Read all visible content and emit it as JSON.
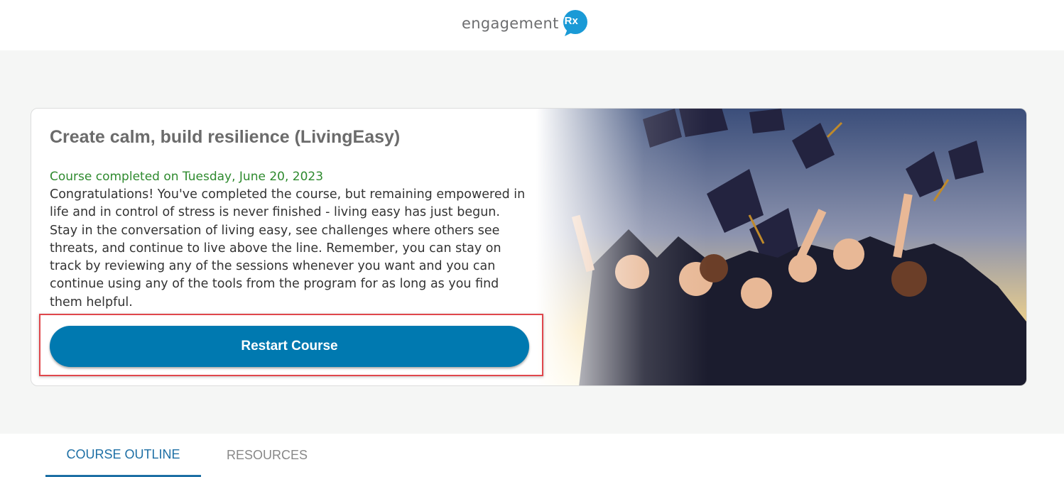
{
  "header": {
    "logo_text": "engagement",
    "logo_badge": "Rx",
    "brand_color": "#1a9ad6"
  },
  "course": {
    "title": "Create calm, build resilience (LivingEasy)",
    "completed_text": "Course completed on Tuesday, June 20, 2023",
    "body": "Congratulations! You've completed the course, but remaining empowered in life and in control of stress is never finished - living easy has just begun. Stay in the conversation of living easy, see challenges where others see threats, and continue to live above the line. Remember, you can stay on track by reviewing any of the sessions whenever you want and you can continue using any of the tools from the program for as long as you find them helpful.",
    "restart_label": "Restart Course",
    "button_color": "#0079b0"
  },
  "tabs": [
    {
      "label": "COURSE OUTLINE",
      "active": true
    },
    {
      "label": "RESOURCES",
      "active": false
    }
  ]
}
